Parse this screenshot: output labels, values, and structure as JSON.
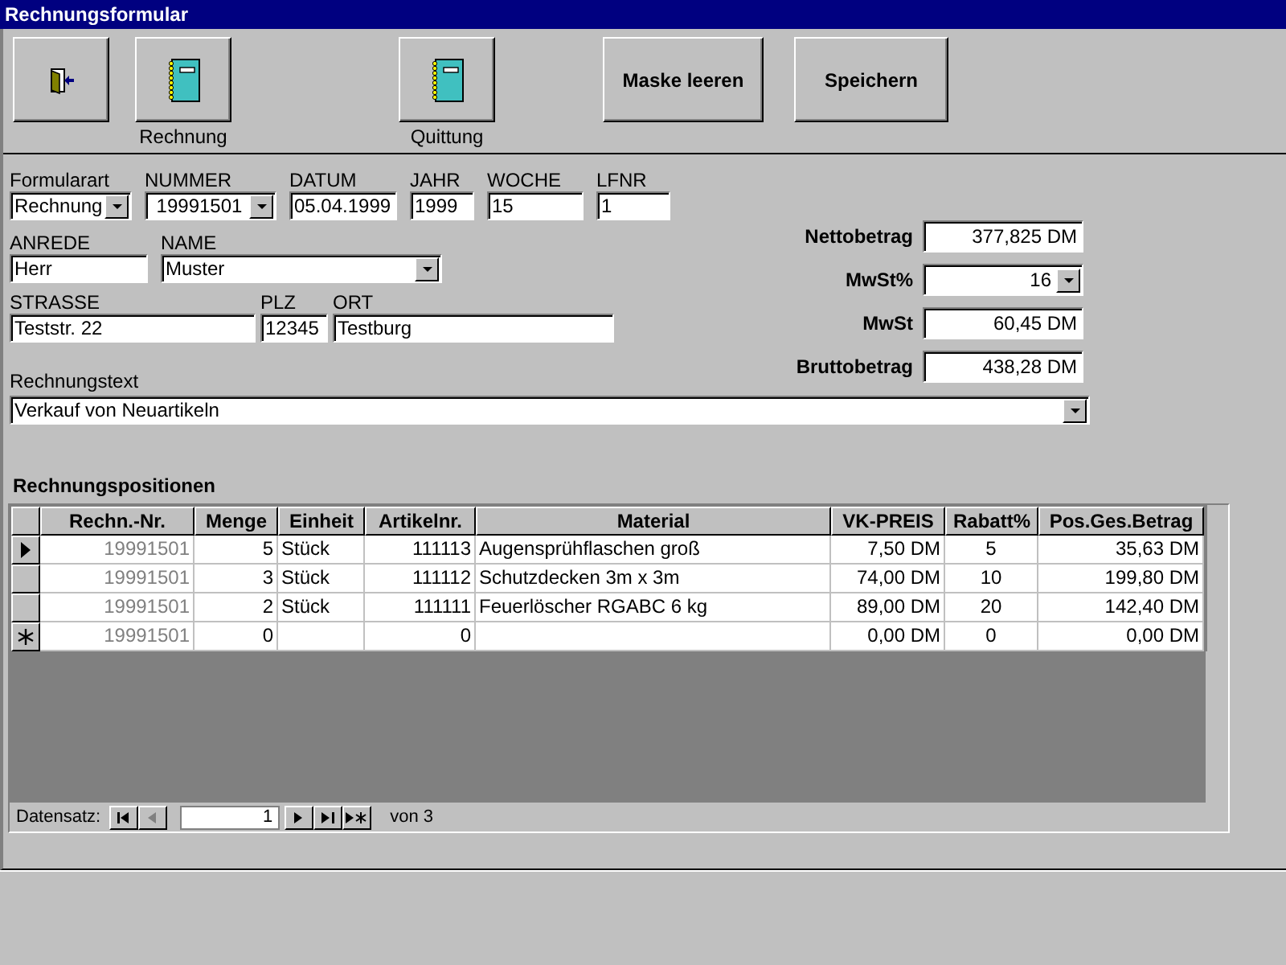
{
  "window": {
    "title": "Rechnungsformular"
  },
  "toolbar": [
    {
      "kind": "exit"
    },
    {
      "kind": "notebook",
      "caption": "Rechnung"
    },
    {
      "kind": "notebook",
      "caption": "Quittung"
    },
    {
      "kind": "text",
      "caption": "Maske leeren"
    },
    {
      "kind": "text",
      "caption": "Speichern"
    }
  ],
  "header_fields": [
    {
      "label": "Formularart",
      "value": "Rechnung",
      "kind": "combo"
    },
    {
      "label": "NUMMER",
      "value": "19991501",
      "kind": "combo"
    },
    {
      "label": "DATUM",
      "value": "05.04.1999",
      "kind": "text"
    },
    {
      "label": "JAHR",
      "value": "1999",
      "kind": "text"
    },
    {
      "label": "WOCHE",
      "value": "15",
      "kind": "text"
    },
    {
      "label": "LFNR",
      "value": "1",
      "kind": "text"
    }
  ],
  "person_fields": [
    {
      "label": "ANREDE",
      "value": "Herr",
      "kind": "text"
    },
    {
      "label": "NAME",
      "value": "Muster",
      "kind": "combo"
    }
  ],
  "address_fields": [
    {
      "label": "STRASSE",
      "value": "Teststr. 22",
      "kind": "text"
    },
    {
      "label": "PLZ",
      "value": "12345",
      "kind": "text"
    },
    {
      "label": "ORT",
      "value": "Testburg",
      "kind": "text"
    }
  ],
  "totals": [
    {
      "label": "Nettobetrag",
      "value": "377,825 DM",
      "kind": "text"
    },
    {
      "label": "MwSt%",
      "value": "16",
      "kind": "combo"
    },
    {
      "label": "MwSt",
      "value": "60,45 DM",
      "kind": "text"
    },
    {
      "label": "Bruttobetrag",
      "value": "438,28 DM",
      "kind": "text"
    }
  ],
  "invoice_text": {
    "label": "Rechnungstext",
    "value": "Verkauf von Neuartikeln",
    "kind": "combo"
  },
  "positions": {
    "title": "Rechnungspositionen",
    "columns": [
      {
        "label": "Rechn.-Nr.",
        "locked": true
      },
      {
        "label": "Menge",
        "locked": false
      },
      {
        "label": "Einheit",
        "locked": false
      },
      {
        "label": "Artikelnr.",
        "locked": false
      },
      {
        "label": "Material",
        "locked": false
      },
      {
        "label": "VK-PREIS",
        "locked": false
      },
      {
        "label": "Rabatt%",
        "locked": false
      },
      {
        "label": "Pos.Ges.Betrag",
        "locked": false
      }
    ],
    "rows": [
      {
        "kind": "current",
        "cells": [
          "19991501",
          "5",
          "Stück",
          "111113",
          "Augensprühflaschen groß",
          "7,50 DM",
          "5",
          "35,63 DM"
        ]
      },
      {
        "kind": "record",
        "cells": [
          "19991501",
          "3",
          "Stück",
          "111112",
          "Schutzdecken 3m x 3m",
          "74,00 DM",
          "10",
          "199,80 DM"
        ]
      },
      {
        "kind": "record",
        "cells": [
          "19991501",
          "2",
          "Stück",
          "111111",
          "Feuerlöscher RGABC 6 kg",
          "89,00 DM",
          "20",
          "142,40 DM"
        ]
      },
      {
        "kind": "new",
        "cells": [
          "19991501",
          "0",
          "",
          "0",
          "",
          "0,00 DM",
          "0",
          "0,00 DM"
        ]
      }
    ],
    "navigation": {
      "label": "Datensatz:",
      "record": "1",
      "total": "von 3"
    }
  }
}
